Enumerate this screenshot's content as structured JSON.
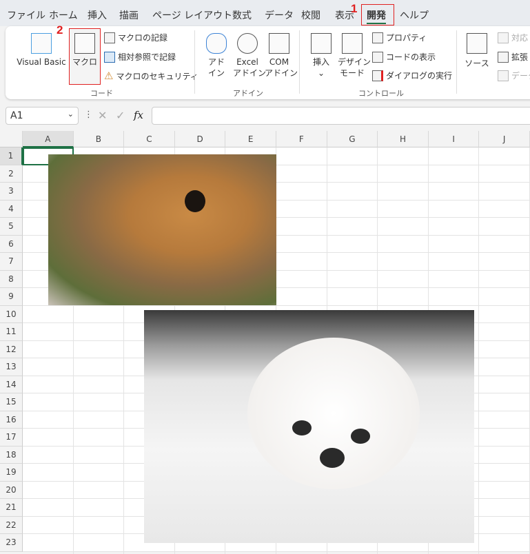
{
  "menu": {
    "tabs": [
      "ファイル",
      "ホーム",
      "挿入",
      "描画",
      "ページ レイアウト",
      "数式",
      "データ",
      "校閲",
      "表示",
      "開発",
      "ヘルプ"
    ],
    "active": "開発"
  },
  "annotations": {
    "step1": "1",
    "step2": "2"
  },
  "ribbon": {
    "code": {
      "visual_basic": "Visual Basic",
      "macro": "マクロ",
      "record_macro": "マクロの記録",
      "relative_ref": "相対参照で記録",
      "macro_security": "マクロのセキュリティ",
      "group": "コード"
    },
    "addins": {
      "addin_l1": "アド",
      "addin_l2": "イン",
      "excel_l1": "Excel",
      "excel_l2": "アドイン",
      "com_l1": "COM",
      "com_l2": "アドイン",
      "group": "アドイン"
    },
    "controls": {
      "insert": "挿入",
      "design_l1": "デザイン",
      "design_l2": "モード",
      "properties": "プロパティ",
      "view_code": "コードの表示",
      "run_dialog": "ダイアログの実行",
      "group": "コントロール"
    },
    "xml": {
      "source": "ソース",
      "map": "対応",
      "expand": "拡張",
      "data": "データ"
    }
  },
  "formula_bar": {
    "name_box": "A1",
    "fx": "fx",
    "formula": ""
  },
  "columns": [
    "A",
    "B",
    "C",
    "D",
    "E",
    "F",
    "G",
    "H",
    "I",
    "J"
  ],
  "rows": [
    "1",
    "2",
    "3",
    "4",
    "5",
    "6",
    "7",
    "8",
    "9",
    "10",
    "11",
    "12",
    "13",
    "14",
    "15",
    "16",
    "17",
    "18",
    "19",
    "20",
    "21",
    "22",
    "23"
  ],
  "colors": {
    "accent": "#1e7145",
    "annotation": "#e02020"
  }
}
